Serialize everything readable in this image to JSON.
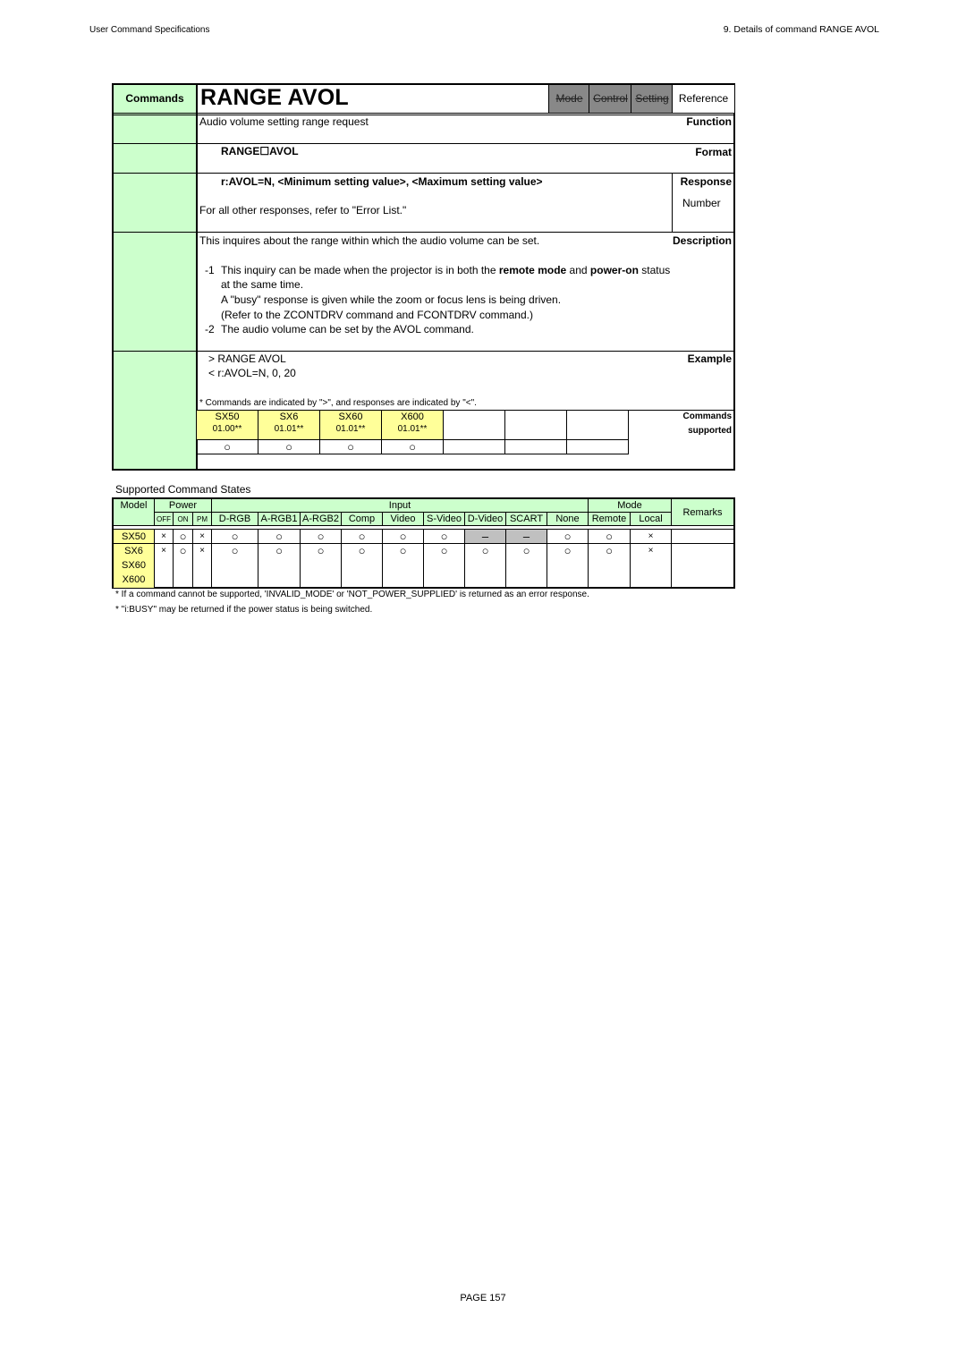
{
  "header": {
    "left": "User Command Specifications",
    "right": "9.  Details of command   RANGE AVOL"
  },
  "spec": {
    "commands_label": "Commands",
    "command_name": "RANGE AVOL",
    "tabs": [
      {
        "label": "Mode",
        "state": "disabled"
      },
      {
        "label": "Control",
        "state": "disabled"
      },
      {
        "label": "Setting",
        "state": "disabled"
      },
      {
        "label": "Reference",
        "state": "active"
      }
    ],
    "function_label": "Function",
    "function_text": "Audio volume setting range request",
    "format_label": "Format",
    "format_text": "RANGE☐AVOL",
    "response_label": "Response",
    "response_text": "r:AVOL=N, <Minimum setting value>, <Maximum setting value>",
    "response_other": "For all other responses, refer to \"Error List.\"",
    "response_type": "Number",
    "description_label": "Description",
    "description_intro": "This inquires about the range within which the audio volume can be set.",
    "notes": [
      {
        "num": "-1",
        "line1_pre": "This inquiry can be made when the projector is in both the ",
        "line1_bold1": "remote mode",
        "line1_mid": " and ",
        "line1_bold2": "power-on",
        "line1_post": " status",
        "line2": "at the same time.",
        "line3": "A \"busy\" response is given while the zoom or focus lens is being driven.",
        "line4": "(Refer to the ZCONTDRV command and FCONTDRV command.)"
      },
      {
        "num": "-2",
        "line1": "The audio volume can be set by the AVOL command."
      }
    ],
    "example_label": "Example",
    "example_lines": [
      "> RANGE AVOL",
      "< r:AVOL=N, 0, 20"
    ],
    "example_note": "* Commands are indicated by \">\", and responses are indicated by \"<\".",
    "supported_label_1": "Commands",
    "supported_label_2": "supported",
    "supported_models": [
      {
        "model": "SX50",
        "version": "01.00**",
        "mark": "○"
      },
      {
        "model": "SX6",
        "version": "01.01**",
        "mark": "○"
      },
      {
        "model": "SX60",
        "version": "01.01**",
        "mark": "○"
      },
      {
        "model": "X600",
        "version": "01.01**",
        "mark": "○"
      }
    ]
  },
  "states": {
    "caption": "Supported Command States",
    "headers": {
      "model": "Model",
      "power": "Power",
      "input": "Input",
      "mode": "Mode",
      "remarks": "Remarks",
      "power_sub": [
        "OFF",
        "ON",
        "PM"
      ],
      "input_sub": [
        "D-RGB",
        "A-RGB1",
        "A-RGB2",
        "Comp",
        "Video",
        "S-Video",
        "D-Video",
        "SCART",
        "None"
      ],
      "mode_sub": [
        "Remote",
        "Local"
      ]
    },
    "rows": [
      {
        "models": [
          "SX50"
        ],
        "cells": [
          "×",
          "○",
          "×",
          "○",
          "○",
          "○",
          "○",
          "○",
          "○",
          "–",
          "–",
          "○",
          "○",
          "×"
        ],
        "remarks": ""
      },
      {
        "models": [
          "SX6",
          "SX60",
          "X600"
        ],
        "cells": [
          "×",
          "○",
          "×",
          "○",
          "○",
          "○",
          "○",
          "○",
          "○",
          "○",
          "○",
          "○",
          "○",
          "×"
        ],
        "remarks": ""
      }
    ],
    "notes": [
      "* If a command cannot be supported, 'INVALID_MODE' or 'NOT_POWER_SUPPLIED' is returned as an error response.",
      "* \"i:BUSY\" may be returned if the power status is being switched."
    ]
  },
  "footer": {
    "page": "PAGE 157"
  },
  "colors": {
    "label_bg": "#ccffcc",
    "model_bg": "#ffff99",
    "disabled_tab": "#888888",
    "unsupported_cell": "#c0c0c0"
  }
}
